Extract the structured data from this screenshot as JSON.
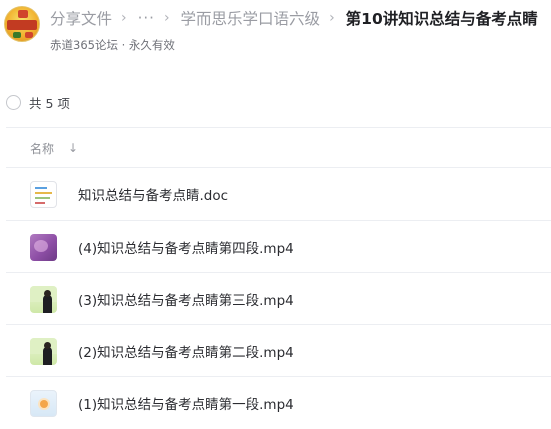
{
  "header": {
    "breadcrumb": {
      "root": "分享文件",
      "ellipsis": "···",
      "parent": "学而思乐学口语六级",
      "current": "第10讲知识总结与备考点睛"
    },
    "subtitle": "赤道365论坛 · 永久有效",
    "separator_glyph": "›"
  },
  "list": {
    "count_text": "共 5 项",
    "column_name_label": "名称",
    "sort_glyph": "↓",
    "files": [
      {
        "name": "知识总结与备考点睛.doc",
        "thumb": "doc-icon"
      },
      {
        "name": "(4)知识总结与备考点睛第四段.mp4",
        "thumb": "video-thumbnail-purple"
      },
      {
        "name": "(3)知识总结与备考点睛第三段.mp4",
        "thumb": "video-thumbnail-teacher"
      },
      {
        "name": "(2)知识总结与备考点睛第二段.mp4",
        "thumb": "video-thumbnail-teacher"
      },
      {
        "name": "(1)知识总结与备考点睛第一段.mp4",
        "thumb": "video-thumbnail-light"
      }
    ]
  },
  "colors": {
    "breadcrumb_inactive": "#9a9ca3",
    "breadcrumb_active": "#1f2024",
    "divider": "#eceef2"
  }
}
